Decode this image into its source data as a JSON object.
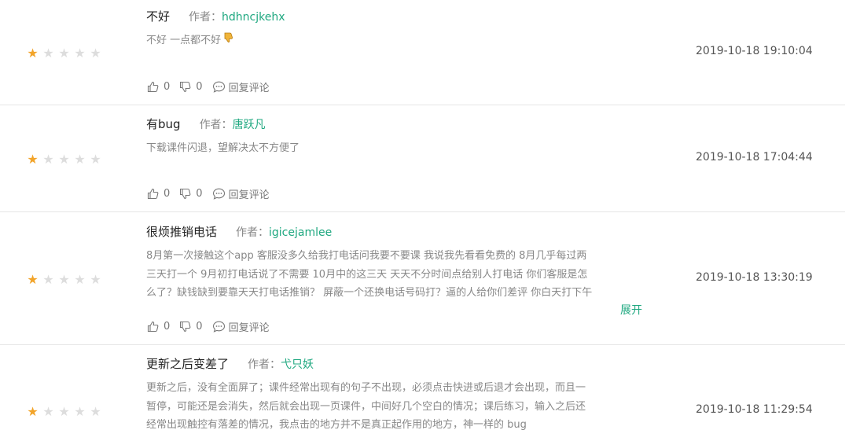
{
  "reviews": [
    {
      "title": "不好",
      "author_label": "作者：",
      "author": "hdhncjkehx",
      "body_lines": [
        "不好 一点都不好"
      ],
      "body_emoji": "thumbs-down-emoji",
      "rating": 1,
      "date": "2019-10-18 19:10:04",
      "likes": "0",
      "dislikes": "0",
      "reply_label": "回复评论"
    },
    {
      "title": "有bug",
      "author_label": "作者：",
      "author": "唐跃凡",
      "body_lines": [
        "下载课件闪退，望解决太不方便了"
      ],
      "rating": 1,
      "date": "2019-10-18 17:04:44",
      "likes": "0",
      "dislikes": "0",
      "reply_label": "回复评论"
    },
    {
      "title": "很烦推销电话",
      "author_label": "作者：",
      "author": "igicejamlee",
      "body_lines": [
        "8月第一次接触这个app 客服没多久给我打电话问我要不要课 我说我先看看免费的 8月几乎每过两",
        "三天打一个 9月初打电话说了不需要 10月中的这三天 天天不分时间点给别人打电话 你们客服是怎",
        "么了？缺钱缺到要靠天天打电话推销？ 屏蔽一个还换电话号码打？逼的人给你们差评 你白天打下午"
      ],
      "expand_label": "展开",
      "rating": 1,
      "date": "2019-10-18 13:30:19",
      "likes": "0",
      "dislikes": "0",
      "reply_label": "回复评论"
    },
    {
      "title": "更新之后变差了",
      "author_label": "作者：",
      "author": "弋只妖",
      "body_lines": [
        "更新之后，没有全面屏了；课件经常出现有的句子不出现，必须点击快进或后退才会出现，而且一",
        "暂停，可能还是会消失，然后就会出现一页课件，中间好几个空白的情况；课后练习，输入之后还",
        "经常出现触控有落差的情况，我点击的地方并不是真正起作用的地方，神一样的 bug"
      ],
      "rating": 1,
      "date": "2019-10-18 11:29:54"
    }
  ],
  "colors": {
    "accent": "#1fa880",
    "star_on": "#f2a42a",
    "star_off": "#dddddd",
    "divider": "#e6e6e6"
  }
}
